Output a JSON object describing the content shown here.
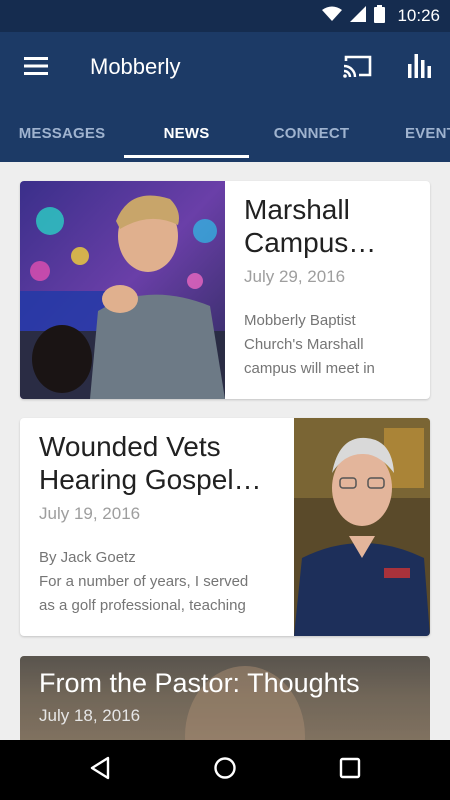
{
  "status_bar": {
    "time": "10:26"
  },
  "app_bar": {
    "title": "Mobberly"
  },
  "tabs": [
    {
      "label": "MESSAGES",
      "active": false
    },
    {
      "label": "NEWS",
      "active": true
    },
    {
      "label": "CONNECT",
      "active": false
    },
    {
      "label": "EVENTS",
      "active": false
    }
  ],
  "cards": [
    {
      "title_line1": "Marshall",
      "title_line2": "Campus…",
      "date": "July 29, 2016",
      "excerpt_line1": "Mobberly Baptist",
      "excerpt_line2": "Church's Marshall",
      "excerpt_line3": "campus will meet in"
    },
    {
      "title_line1": "Wounded Vets",
      "title_line2": "Hearing Gospel…",
      "date": "July 19, 2016",
      "excerpt_line1": "By Jack Goetz",
      "excerpt_line2": "For a number of years, I served",
      "excerpt_line3": "as a golf professional, teaching"
    },
    {
      "title": "From the Pastor: Thoughts",
      "date": "July 18, 2016"
    }
  ],
  "colors": {
    "primary": "#1c3a66",
    "status_bar": "#152c4f",
    "tab_inactive": "#9fb3cf"
  },
  "icons": [
    "wifi-icon",
    "signal-icon",
    "battery-icon",
    "menu-icon",
    "cast-icon",
    "bar-chart-icon",
    "back-icon",
    "home-icon",
    "recents-icon"
  ]
}
